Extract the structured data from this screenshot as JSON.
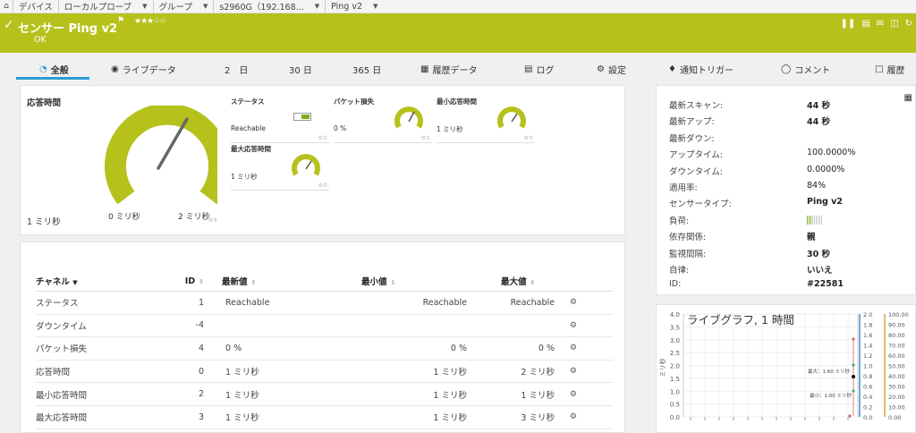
{
  "breadcrumb": {
    "items": [
      "デバイス",
      "ローカルプローブ",
      "グループ",
      "s2960G（192.168...",
      "Ping v2"
    ]
  },
  "sensor": {
    "title": "センサー Ping v2",
    "stars": "★★★☆☆",
    "status": "OK",
    "accent_color": "#b6c11b"
  },
  "tabs": [
    {
      "label": "全般",
      "icon": "gauge-icon"
    },
    {
      "label": "ライブデータ",
      "icon": "broadcast-icon"
    },
    {
      "label": "2　日",
      "icon": ""
    },
    {
      "label": "30 日",
      "icon": ""
    },
    {
      "label": "365 日",
      "icon": ""
    },
    {
      "label": "履歴データ",
      "icon": "chart-icon"
    },
    {
      "label": "ログ",
      "icon": "log-icon"
    },
    {
      "label": "設定",
      "icon": "gear-icon"
    },
    {
      "label": "通知トリガー",
      "icon": "bell-icon"
    },
    {
      "label": "コメント",
      "icon": "comment-icon"
    },
    {
      "label": "履歴",
      "icon": "history-icon"
    }
  ],
  "gauges": {
    "response_time": {
      "label": "応答時間",
      "value": "1 ミリ秒",
      "min_label": "0 ミリ秒",
      "max_label": "2 ミリ秒",
      "level": 0.5
    },
    "status": {
      "label": "ステータス",
      "value": "Reachable"
    },
    "packet_loss": {
      "label": "パケット損失",
      "value": "0 %",
      "level": 0.55
    },
    "min_response": {
      "label": "最小応答時間",
      "value": "1 ミリ秒",
      "level": 0.6
    },
    "max_response": {
      "label": "最大応答時間",
      "value": "1 ミリ秒",
      "level": 0.6
    }
  },
  "table": {
    "headers": {
      "channel": "チャネル",
      "id": "ID",
      "last": "最新値",
      "min": "最小値",
      "max": "最大値"
    },
    "rows": [
      {
        "channel": "ステータス",
        "id": "1",
        "last": "Reachable",
        "min": "Reachable",
        "max": "Reachable"
      },
      {
        "channel": "ダウンタイム",
        "id": "-4",
        "last": "",
        "min": "",
        "max": ""
      },
      {
        "channel": "パケット損失",
        "id": "4",
        "last": "0 %",
        "min": "0 %",
        "max": "0 %"
      },
      {
        "channel": "応答時間",
        "id": "0",
        "last": "1 ミリ秒",
        "min": "1 ミリ秒",
        "max": "2 ミリ秒"
      },
      {
        "channel": "最小応答時間",
        "id": "2",
        "last": "1 ミリ秒",
        "min": "1 ミリ秒",
        "max": "1 ミリ秒"
      },
      {
        "channel": "最大応答時間",
        "id": "3",
        "last": "1 ミリ秒",
        "min": "1 ミリ秒",
        "max": "3 ミリ秒"
      }
    ]
  },
  "info": [
    {
      "key": "最新スキャン:",
      "value": "44 秒"
    },
    {
      "key": "最新アップ:",
      "value": "44 秒"
    },
    {
      "key": "最新ダウン:",
      "value": ""
    },
    {
      "key": "アップタイム:",
      "value": "100.0000%"
    },
    {
      "key": "ダウンタイム:",
      "value": "0.0000%"
    },
    {
      "key": "適用率:",
      "value": "84%"
    },
    {
      "key": "センサータイプ:",
      "value": "Ping v2"
    },
    {
      "key": "負荷:",
      "value": "",
      "level": 0.3
    },
    {
      "key": "依存関係:",
      "value": "親"
    },
    {
      "key": "監視間隔:",
      "value": "30 秒"
    },
    {
      "key": "自律:",
      "value": "いいえ"
    },
    {
      "key": "ID:",
      "value": "#22581"
    }
  ],
  "live_graph": {
    "title": "ライブグラフ, 1 時間",
    "ylabel": "ミリ秒",
    "y_left_ticks": [
      "4.0",
      "3.5",
      "3.0",
      "2.5",
      "2.0",
      "1.5",
      "1.0",
      "0.5",
      "0.0"
    ],
    "y_mid_ticks": [
      "2.0",
      "1.8",
      "1.6",
      "1.4",
      "1.2",
      "1.0",
      "0.8",
      "0.6",
      "0.4",
      "0.2",
      "0.0"
    ],
    "y_right_ticks": [
      "100.00",
      "90.00",
      "80.00",
      "70.00",
      "60.00",
      "50.00",
      "40.00",
      "30.00",
      "20.00",
      "10.00",
      "0.00"
    ],
    "annot_max": "最大：1.60 ミリ秒",
    "annot_min": "最小：1.00 ミリ秒",
    "left_color": "#4a90d0",
    "right_color": "#e0a040"
  }
}
